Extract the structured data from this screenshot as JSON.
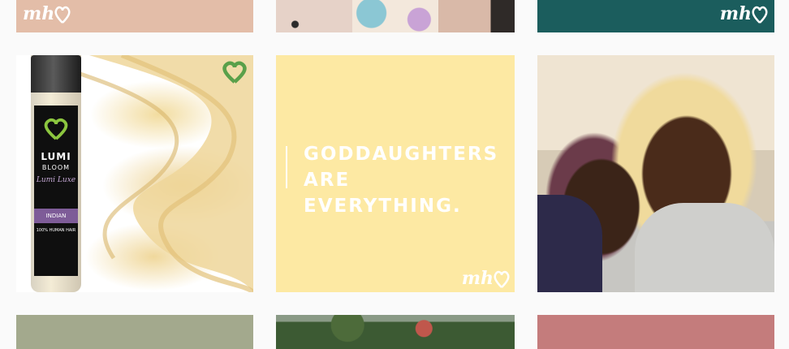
{
  "grid": {
    "row0": {
      "tile1": {
        "logo": "mh",
        "color": "#e3bda8"
      },
      "tile2": {
        "type": "photo"
      },
      "tile3": {
        "logo": "mh",
        "color": "#1b5d5d"
      }
    },
    "row1": {
      "tile1": {
        "type": "product-photo",
        "brand": "LUMI",
        "brand_line2": "BLOOM",
        "collection": "Lumi Luxe",
        "band_text": "INDIAN",
        "small_text": "100% HUMAN HAIR"
      },
      "tile2": {
        "quote_line1": "GODDAUGHTERS",
        "quote_line2": "ARE EVERYTHING.",
        "logo": "mh",
        "color": "#fde9a3"
      },
      "tile3": {
        "type": "photo"
      }
    },
    "row2": {
      "tile1": {
        "color": "#a3a98d"
      },
      "tile2": {
        "type": "photo"
      },
      "tile3": {
        "color": "#c47c7c"
      }
    }
  }
}
